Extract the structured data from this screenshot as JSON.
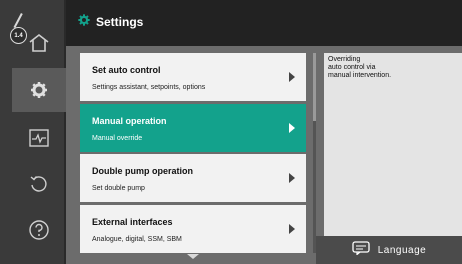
{
  "sidebar": {
    "badge_text": "1.4",
    "items": [
      {
        "icon": "home-icon",
        "active": false
      },
      {
        "icon": "gear-icon",
        "active": true
      },
      {
        "icon": "pulse-monitor-icon",
        "active": false
      },
      {
        "icon": "undo-icon",
        "active": false
      },
      {
        "icon": "help-icon",
        "active": false
      }
    ]
  },
  "header": {
    "title": "Settings",
    "icon": "gear-icon"
  },
  "menu": {
    "items": [
      {
        "title": "Set auto control",
        "subtitle": "Settings assistant, setpoints, options",
        "active": false
      },
      {
        "title": "Manual operation",
        "subtitle": "Manual override",
        "active": true
      },
      {
        "title": "Double pump operation",
        "subtitle": "Set double pump",
        "active": false
      },
      {
        "title": "External interfaces",
        "subtitle": "Analogue, digital, SSM, SBM",
        "active": false
      }
    ]
  },
  "info_panel": {
    "text": "Overriding\nauto control via\nmanual intervention."
  },
  "language_button": {
    "label": "Language",
    "icon": "chat-icon"
  },
  "colors": {
    "accent": "#13a28c",
    "header_bg": "#222222",
    "item_bg": "#f2f2f2"
  }
}
